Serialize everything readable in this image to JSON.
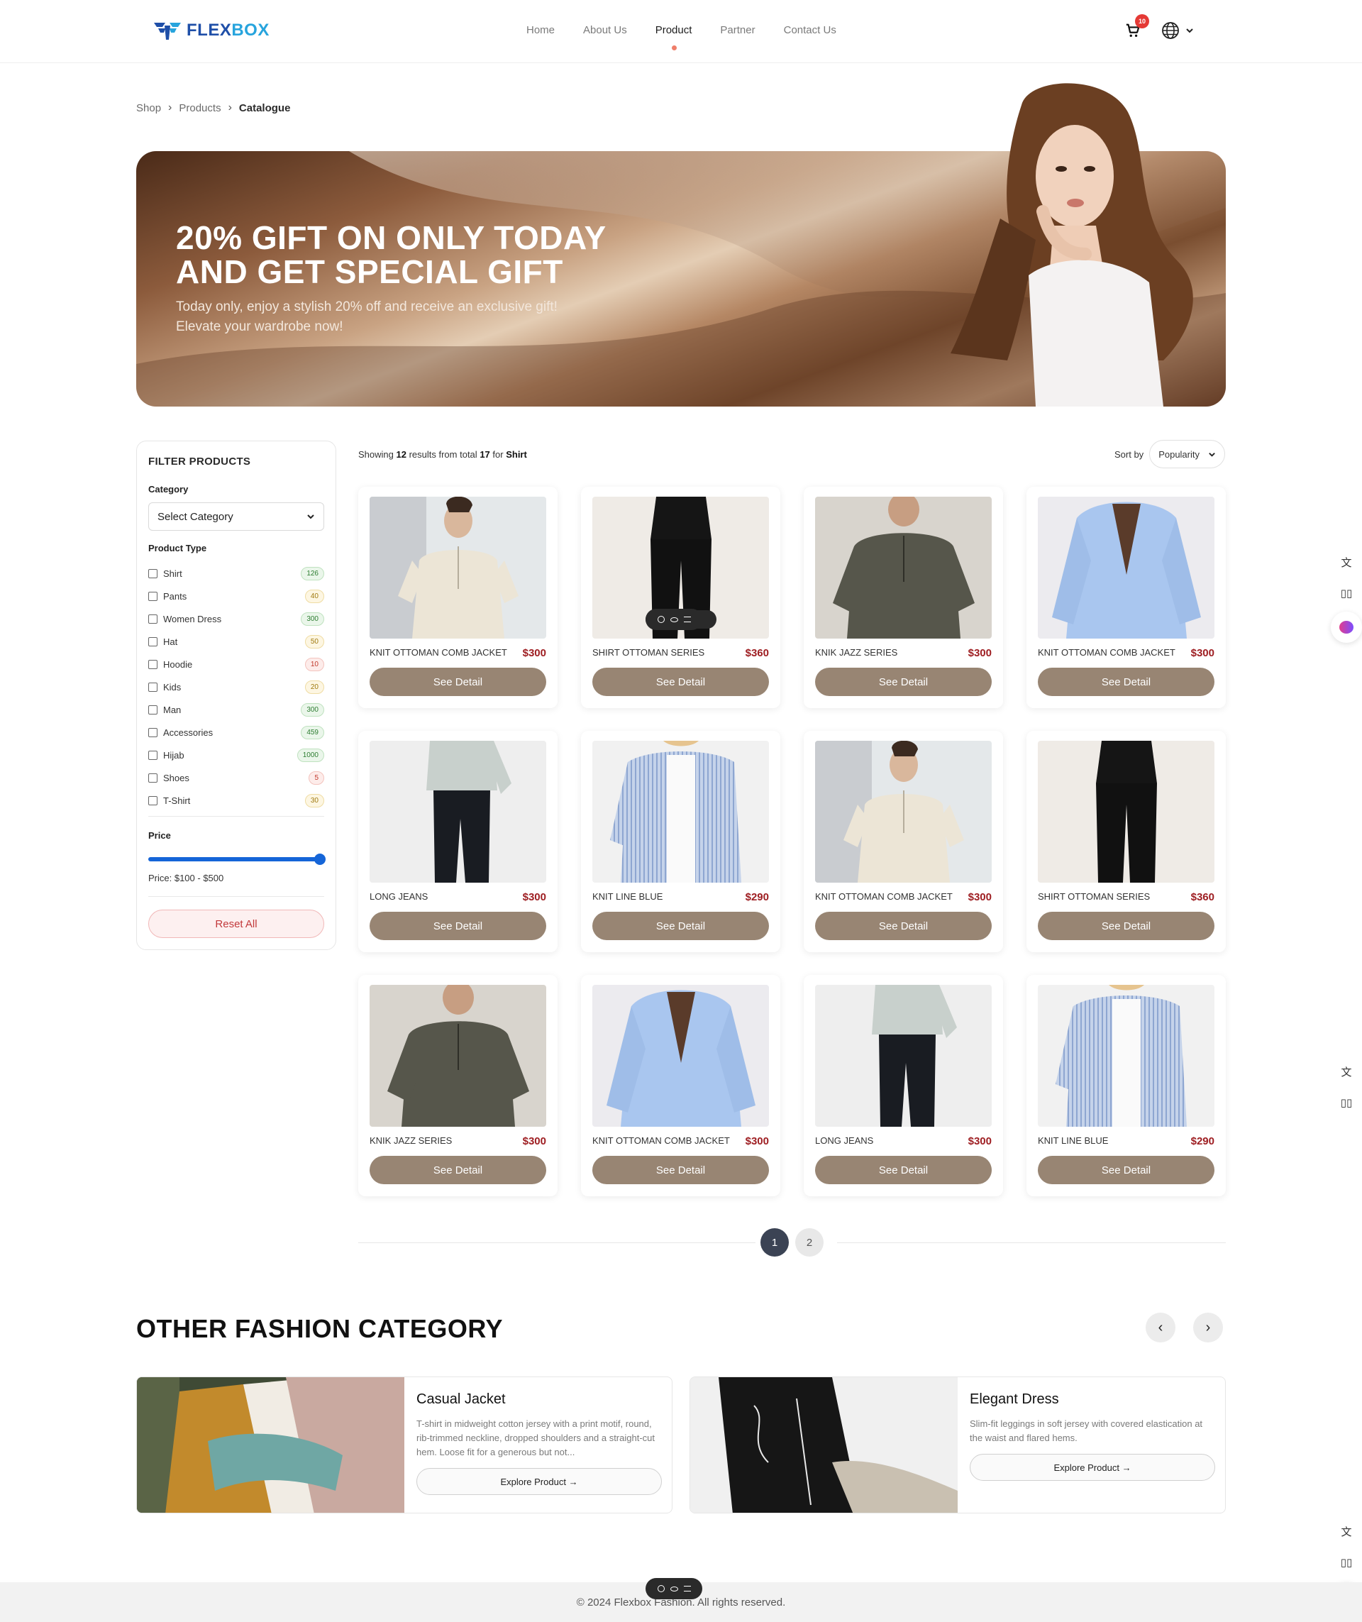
{
  "brand": {
    "part1": "FLEX",
    "part2": "BOX"
  },
  "nav": {
    "items": [
      "Home",
      "About Us",
      "Product",
      "Partner",
      "Contact Us"
    ],
    "active": "Product"
  },
  "cart": {
    "count": "10"
  },
  "breadcrumb": [
    "Shop",
    "Products",
    "Catalogue"
  ],
  "hero": {
    "title_line1": "20% GIFT ON ONLY TODAY",
    "title_line2": "AND GET SPECIAL GIFT",
    "subtitle_line1": "Today only, enjoy a stylish 20% off and receive an exclusive gift!",
    "subtitle_line2": "Elevate your wardrobe now!"
  },
  "filter": {
    "title": "FILTER PRODUCTS",
    "category_label": "Category",
    "category_value": "Select Category",
    "product_type_label": "Product Type",
    "types": [
      {
        "label": "Shirt",
        "count": "126",
        "tone": "green"
      },
      {
        "label": "Pants",
        "count": "40",
        "tone": "yellow"
      },
      {
        "label": "Women Dress",
        "count": "300",
        "tone": "green"
      },
      {
        "label": "Hat",
        "count": "50",
        "tone": "yellow"
      },
      {
        "label": "Hoodie",
        "count": "10",
        "tone": "red"
      },
      {
        "label": "Kids",
        "count": "20",
        "tone": "yellow"
      },
      {
        "label": "Man",
        "count": "300",
        "tone": "green"
      },
      {
        "label": "Accessories",
        "count": "459",
        "tone": "green"
      },
      {
        "label": "Hijab",
        "count": "1000",
        "tone": "green"
      },
      {
        "label": "Shoes",
        "count": "5",
        "tone": "red"
      },
      {
        "label": "T-Shirt",
        "count": "30",
        "tone": "yellow"
      }
    ],
    "price_label": "Price",
    "price_range": "Price: $100 - $500",
    "reset_label": "Reset All"
  },
  "results": {
    "prefix": "Showing",
    "shown": "12",
    "middle": "results from total",
    "total": "17",
    "for_word": "for",
    "query": "Shirt"
  },
  "sort": {
    "label": "Sort by",
    "value": "Popularity"
  },
  "products": [
    {
      "name": "KNIT OTTOMAN COMB JACKET",
      "price": "$300",
      "button": "See Detail",
      "img": "cream-polo"
    },
    {
      "name": "SHIRT OTTOMAN SERIES",
      "price": "$360",
      "button": "See Detail",
      "img": "black-outfit"
    },
    {
      "name": "KNIK JAZZ SERIES",
      "price": "$300",
      "button": "See Detail",
      "img": "olive-polo"
    },
    {
      "name": "KNIT OTTOMAN COMB JACKET",
      "price": "$300",
      "button": "See Detail",
      "img": "blue-shirt"
    },
    {
      "name": "LONG JEANS",
      "price": "$300",
      "button": "See Detail",
      "img": "jeans"
    },
    {
      "name": "KNIT LINE BLUE",
      "price": "$290",
      "button": "See Detail",
      "img": "striped-shirt"
    },
    {
      "name": "KNIT OTTOMAN COMB JACKET",
      "price": "$300",
      "button": "See Detail",
      "img": "cream-polo"
    },
    {
      "name": "SHIRT OTTOMAN SERIES",
      "price": "$360",
      "button": "See Detail",
      "img": "black-outfit"
    },
    {
      "name": "KNIK JAZZ SERIES",
      "price": "$300",
      "button": "See Detail",
      "img": "olive-polo"
    },
    {
      "name": "KNIT OTTOMAN COMB JACKET",
      "price": "$300",
      "button": "See Detail",
      "img": "blue-shirt"
    },
    {
      "name": "LONG JEANS",
      "price": "$300",
      "button": "See Detail",
      "img": "jeans"
    },
    {
      "name": "KNIT LINE BLUE",
      "price": "$290",
      "button": "See Detail",
      "img": "striped-shirt"
    }
  ],
  "pagination": {
    "pages": [
      "1",
      "2"
    ],
    "current": "1"
  },
  "other": {
    "title": "OTHER FASHION CATEGORY",
    "cards": [
      {
        "title": "Casual Jacket",
        "desc": "T-shirt in midweight cotton jersey with a print motif, round, rib-trimmed neckline, dropped shoulders and a straight-cut hem. Loose fit for a generous but not...",
        "button": "Explore Product"
      },
      {
        "title": "Elegant Dress",
        "desc": "Slim-fit leggings in soft jersey with covered elastication at the waist and flared hems.",
        "button": "Explore Product"
      }
    ]
  },
  "footer": {
    "text": "© 2024 Flexbox Fashion. All rights reserved."
  },
  "colors": {
    "accent": "#988573",
    "price": "#9e1e22",
    "slider": "#1565d8",
    "active_dot": "#ef7e6a"
  }
}
